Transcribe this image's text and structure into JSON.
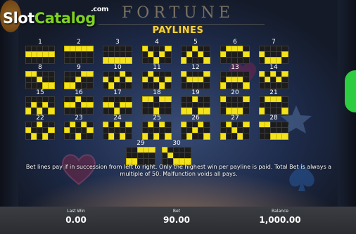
{
  "watermark": {
    "slot": "Slot",
    "catalog": "Catalog",
    "com": ".com"
  },
  "header": {
    "game_title": "FORTUNE",
    "paylines_title": "PAYLINES"
  },
  "paylines": [
    {
      "number": "1",
      "pattern": [
        1,
        1,
        1,
        1,
        1
      ]
    },
    {
      "number": "2",
      "pattern": [
        0,
        0,
        0,
        0,
        0
      ]
    },
    {
      "number": "3",
      "pattern": [
        2,
        2,
        2,
        2,
        2
      ]
    },
    {
      "number": "4",
      "pattern": [
        0,
        1,
        2,
        1,
        0
      ]
    },
    {
      "number": "5",
      "pattern": [
        2,
        1,
        0,
        1,
        2
      ]
    },
    {
      "number": "6",
      "pattern": [
        1,
        0,
        0,
        0,
        1
      ]
    },
    {
      "number": "7",
      "pattern": [
        1,
        2,
        2,
        2,
        1
      ]
    },
    {
      "number": "8",
      "pattern": [
        0,
        0,
        1,
        2,
        2
      ]
    },
    {
      "number": "9",
      "pattern": [
        2,
        2,
        1,
        0,
        0
      ]
    },
    {
      "number": "10",
      "pattern": [
        1,
        2,
        1,
        0,
        1
      ]
    },
    {
      "number": "11",
      "pattern": [
        1,
        0,
        1,
        2,
        1
      ]
    },
    {
      "number": "12",
      "pattern": [
        0,
        1,
        1,
        1,
        0
      ]
    },
    {
      "number": "13",
      "pattern": [
        2,
        1,
        1,
        1,
        2
      ]
    },
    {
      "number": "14",
      "pattern": [
        0,
        1,
        0,
        1,
        0
      ]
    },
    {
      "number": "15",
      "pattern": [
        2,
        1,
        2,
        1,
        2
      ]
    },
    {
      "number": "16",
      "pattern": [
        1,
        1,
        0,
        1,
        1
      ]
    },
    {
      "number": "17",
      "pattern": [
        1,
        1,
        2,
        1,
        1
      ]
    },
    {
      "number": "18",
      "pattern": [
        0,
        0,
        2,
        0,
        0
      ]
    },
    {
      "number": "19",
      "pattern": [
        2,
        2,
        0,
        2,
        2
      ]
    },
    {
      "number": "20",
      "pattern": [
        0,
        2,
        2,
        2,
        0
      ]
    },
    {
      "number": "21",
      "pattern": [
        2,
        0,
        0,
        0,
        2
      ]
    },
    {
      "number": "22",
      "pattern": [
        1,
        2,
        0,
        2,
        1
      ]
    },
    {
      "number": "23",
      "pattern": [
        1,
        0,
        2,
        0,
        1
      ]
    },
    {
      "number": "24",
      "pattern": [
        0,
        2,
        0,
        2,
        0
      ]
    },
    {
      "number": "25",
      "pattern": [
        2,
        0,
        2,
        0,
        2
      ]
    },
    {
      "number": "26",
      "pattern": [
        0,
        2,
        1,
        0,
        2
      ]
    },
    {
      "number": "27",
      "pattern": [
        2,
        0,
        1,
        2,
        0
      ]
    },
    {
      "number": "28",
      "pattern": [
        0,
        0,
        2,
        2,
        2
      ]
    },
    {
      "number": "29",
      "pattern": [
        2,
        2,
        0,
        0,
        0
      ]
    },
    {
      "number": "30",
      "pattern": [
        0,
        1,
        2,
        2,
        2
      ]
    }
  ],
  "rules_text": "Bet lines pay if in succession from left to right. Only the highest win per payline is paid. Total Bet is always a multiple of 50. Malfunction voids all pays.",
  "footer": {
    "last_win_label": "Last Win",
    "last_win_value": "0.00",
    "bet_label": "Bet",
    "bet_value": "90.00",
    "balance_label": "Balance",
    "balance_value": "1,000.00"
  },
  "colors": {
    "line_on": "#f4e21c",
    "line_off": "#1c1c1c",
    "title": "#f7d23a",
    "watermark_green": "#7ed321"
  }
}
